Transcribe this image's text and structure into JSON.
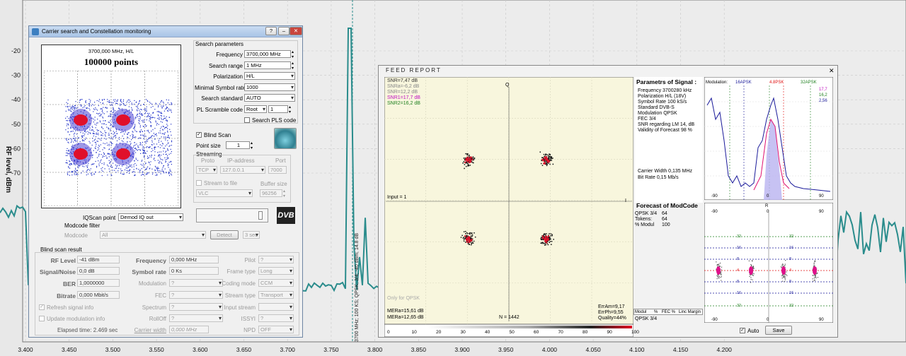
{
  "background_plot": {
    "y_ticks": [
      "-20",
      "-30",
      "-40",
      "-50",
      "-60",
      "-70"
    ],
    "x_ticks": [
      "3.400",
      "3.450",
      "3.500",
      "3.550",
      "3.600",
      "3.650",
      "3.700",
      "3.750",
      "3.800",
      "3.850",
      "3.900",
      "3.950",
      "4.000",
      "4.050",
      "4.100",
      "4.150",
      "4.200"
    ],
    "y_axis_label": "RF level, dBm",
    "marker_label": "3700 MHz; 100 KS; QPSK; 3/4; -40 dBm; 14.8 dB",
    "trace_color": "#2a8c8c"
  },
  "carrier_window": {
    "title": "Carrier search and Constellation monitoring",
    "title_controls": [
      "?",
      "–",
      "✕"
    ],
    "constellation": {
      "freq_label": "3700,000 MHz, H/L",
      "points_label": "100000 points"
    },
    "search": {
      "heading": "Search parameters",
      "frequency_label": "Frequency",
      "frequency_value": "3700,000 MHz",
      "range_label": "Search range",
      "range_value": "1 MHz",
      "polarization_label": "Polarization",
      "polarization_value": "H/L",
      "min_sr_label": "Minimal Symbol rate",
      "min_sr_value": "1000",
      "standard_label": "Search standard",
      "standard_value": "AUTO",
      "pls_label": "PL Scramble code",
      "pls_mode": "Root",
      "pls_value": "1",
      "search_pls_label": "Search PLS code"
    },
    "blind_scan_label": "Blind Scan",
    "point_size_label": "Point size",
    "point_size_value": "1",
    "streaming": {
      "heading": "Streaming",
      "proto_label": "Proto",
      "ip_label": "IP-address",
      "port_label": "Port",
      "proto_value": "TCP",
      "ip_value": "127.0.0.1",
      "port_value": "7000",
      "stream_file_label": "Stream to file",
      "buffer_label": "Buffer size",
      "player_value": "VLC",
      "buffer_value": "96256"
    },
    "iqscan_label": "IQScan point",
    "iqscan_value": "Demod IQ out",
    "modcode": {
      "heading": "Modcode filter",
      "label": "Modcode",
      "value": "All",
      "detect_label": "Detect",
      "interval_value": "3 sec"
    },
    "dvb_logo": "DVB",
    "result": {
      "heading": "Blind scan result",
      "rf_label": "RF Level",
      "rf_value": "-41 dBm",
      "sn_label": "Signal/Noise",
      "sn_value": "0,0 dB",
      "ber_label": "BER",
      "ber_value": "1,0000000",
      "bitrate_label": "Bitrate",
      "bitrate_value": "0,000 Mbit/s",
      "freq_label": "Frequency",
      "freq_value": "0,000 MHz",
      "sr_label": "Symbol rate",
      "sr_value": "0 Ks",
      "mod_label": "Modulation",
      "mod_value": "?",
      "fec_label": "FEC",
      "fec_value": "?",
      "spectrum_label": "Spectrum",
      "spectrum_value": "?",
      "rolloff_label": "RollOff",
      "rolloff_value": "?",
      "carrier_width_label": "Carrier width",
      "carrier_width_value": "0,000 MHz",
      "pilot_label": "Pilot",
      "pilot_value": "?",
      "frame_label": "Frame type",
      "frame_value": "Long",
      "coding_label": "Coding mode",
      "coding_value": "CCM",
      "stream_type_label": "Stream type",
      "stream_type_value": "Transport",
      "input_stream_label": "Input stream",
      "input_stream_value": "",
      "issyi_label": "ISSYI",
      "issyi_value": "?",
      "npd_label": "NPD",
      "npd_value": "OFF",
      "refresh_label": "Refresh signal info",
      "update_mod_label": "Update modulation info",
      "elapsed_label": "Elapsed time: 2.469 sec"
    }
  },
  "feed_report": {
    "title": "FEED REPORT",
    "close": "✕",
    "constellation": {
      "snr_lines": [
        "SNR=7,47 dB",
        "SNRa=-6,2 dB",
        "SNR=12,2 dB",
        "SNR1=17,7 dB",
        "SNR2=16,2 dB"
      ],
      "axis_q": "Q",
      "axis_i": "I",
      "input_label": "Input = 1",
      "only_for": "Only for QPSK",
      "mer_a": "MERa=15,61 dB",
      "mer_b": "MERa=12,65 dB",
      "n_label": "N = 1442",
      "err_a": "ErrAm=9,17",
      "err_p": "ErrPh=9,55",
      "quality": "Quality=44%",
      "scale_ticks": [
        "0",
        "10",
        "20",
        "30",
        "40",
        "50",
        "60",
        "70",
        "80",
        "90",
        "100"
      ]
    },
    "params": {
      "heading": "Parametrs of Signal :",
      "lines": [
        "Frequency  3700280 kHz",
        "Polarization  H/L (18V)",
        "Symbol Rate  100 kS/s",
        "Standard  DVB-S",
        "Modulation  QPSK",
        "FEC  3/4",
        "SNR regarding LM  14, dB",
        "Validity of Forecast  98 %"
      ],
      "carrier_width": "Carrier Width  0,135 MHz",
      "bit_rate": "Bit Rate  0,15 Mb/s"
    },
    "forecast": {
      "heading": "Forecast of ModCode",
      "rows": [
        [
          "QPSK 3/4",
          "64"
        ],
        [
          "Tokens:",
          "64"
        ],
        [
          "% Modul",
          "100"
        ]
      ],
      "table_header": [
        "Modul",
        "%",
        "FEC %",
        "Linc Margin"
      ],
      "table_row": "QPSK 3/4"
    },
    "histogram": {
      "modulation_label": "Modulation:",
      "mod1": "16APSK",
      "mod2": "4.8PSK",
      "mod3": "32APSK",
      "val1": "17,7",
      "val2": "16,2",
      "val3": "2,56",
      "x_ticks": [
        "-90",
        "0",
        "90"
      ]
    },
    "polar": {
      "axis_r": "R",
      "ticks": [
        "-90",
        "0",
        "90"
      ],
      "ring_labels": [
        "32",
        "16",
        "8",
        "4",
        "8",
        "16",
        "32"
      ]
    },
    "auto_label": "Auto",
    "save_label": "Save"
  },
  "colors": {
    "accent": "#1a3f9a",
    "trace": "#2a8c8c",
    "constellation_point": "#e0102a",
    "plot_bg": "#f8f6dd"
  }
}
